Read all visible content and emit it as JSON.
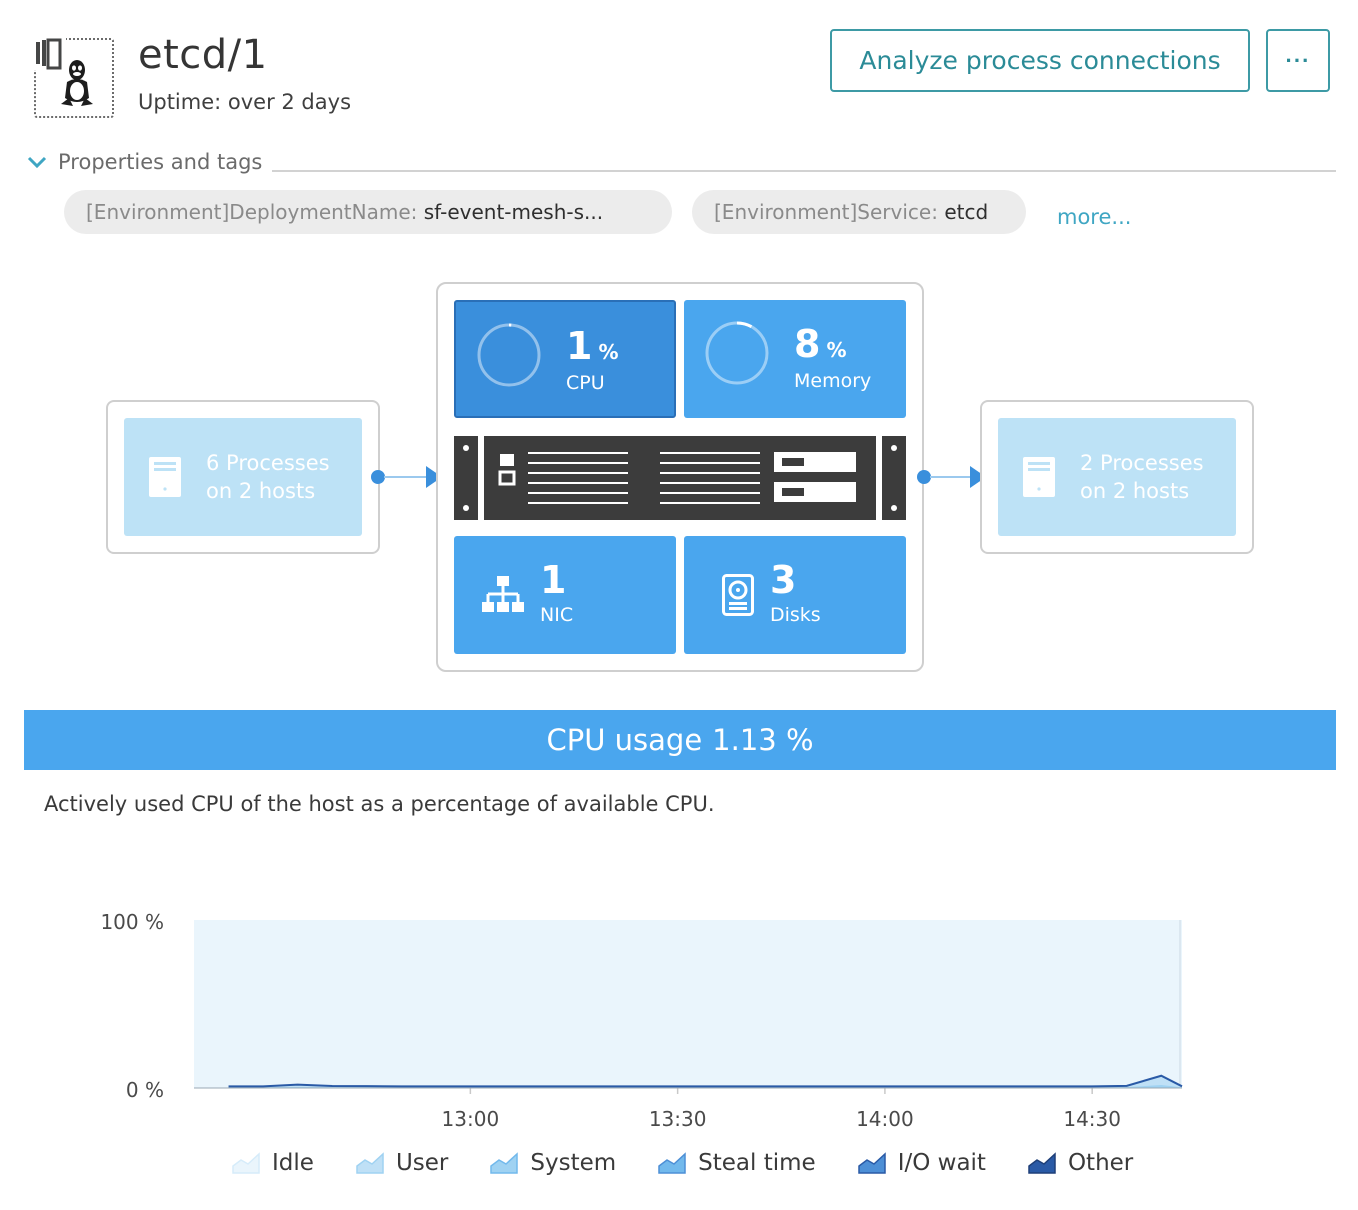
{
  "header": {
    "title": "etcd/1",
    "uptime": "Uptime: over 2 days",
    "analyze_button": "Analyze process connections",
    "more_button": "···"
  },
  "properties": {
    "label": "Properties and tags",
    "tags": [
      {
        "key": "[Environment]DeploymentName:",
        "value": "sf-event-mesh-s..."
      },
      {
        "key": "[Environment]Service:",
        "value": "etcd"
      }
    ],
    "more_link": "more..."
  },
  "infographic": {
    "incoming": {
      "line1": "6 Processes",
      "line2": "on 2 hosts"
    },
    "outgoing": {
      "line1": "2 Processes",
      "line2": "on 2 hosts"
    },
    "cpu": {
      "value": "1",
      "unit": "%",
      "label": "CPU",
      "fraction": 0.01
    },
    "memory": {
      "value": "8",
      "unit": "%",
      "label": "Memory",
      "fraction": 0.08
    },
    "nic": {
      "value": "1",
      "label": "NIC"
    },
    "disks": {
      "value": "3",
      "label": "Disks"
    }
  },
  "banner": {
    "title": "CPU usage",
    "value": "1.13 %"
  },
  "description": "Actively used CPU of the host as a percentage of available CPU.",
  "colors": {
    "accent": "#4aa6ee",
    "accent_dark": "#3a8fdc",
    "teal": "#2b8b97",
    "chart_bg": "#eaf5fc",
    "idle": "#eaf5fc",
    "user": "#bfe0f6",
    "system": "#9fd2f2",
    "steal": "#72b9ec",
    "iowait": "#4d8fd6",
    "other": "#2a5aa6"
  },
  "chart_data": {
    "type": "area",
    "x": [
      "12:25",
      "12:30",
      "12:35",
      "12:40",
      "12:45",
      "12:50",
      "12:55",
      "13:00",
      "13:05",
      "13:10",
      "13:15",
      "13:20",
      "13:25",
      "13:30",
      "13:35",
      "13:40",
      "13:45",
      "13:50",
      "13:55",
      "14:00",
      "14:05",
      "14:10",
      "14:15",
      "14:20",
      "14:25",
      "14:30",
      "14:35",
      "14:40",
      "14:43"
    ],
    "x_ticks": [
      "13:00",
      "13:30",
      "14:00",
      "14:30"
    ],
    "y_ticks": [
      "0 %",
      "100 %"
    ],
    "ylim": [
      0,
      100
    ],
    "series": [
      {
        "name": "Idle",
        "values": [
          99,
          99,
          98,
          99,
          99,
          99,
          99,
          99,
          99,
          99,
          99,
          99,
          99,
          99,
          99,
          99,
          99,
          99,
          99,
          99,
          99,
          99,
          99,
          99,
          99,
          99,
          99,
          92,
          99
        ]
      },
      {
        "name": "User",
        "values": [
          0.6,
          0.6,
          1.4,
          0.8,
          0.7,
          0.6,
          0.6,
          0.6,
          0.6,
          0.6,
          0.6,
          0.6,
          0.6,
          0.6,
          0.6,
          0.6,
          0.6,
          0.6,
          0.6,
          0.6,
          0.6,
          0.6,
          0.6,
          0.6,
          0.6,
          0.6,
          0.8,
          5.5,
          0.6
        ]
      },
      {
        "name": "System",
        "values": [
          0.3,
          0.3,
          0.5,
          0.3,
          0.3,
          0.3,
          0.3,
          0.3,
          0.3,
          0.3,
          0.3,
          0.3,
          0.3,
          0.3,
          0.3,
          0.3,
          0.3,
          0.3,
          0.3,
          0.3,
          0.3,
          0.3,
          0.3,
          0.3,
          0.3,
          0.3,
          0.4,
          1.5,
          0.3
        ]
      },
      {
        "name": "Steal time",
        "values": [
          0,
          0,
          0,
          0,
          0,
          0,
          0,
          0,
          0,
          0,
          0,
          0,
          0,
          0,
          0,
          0,
          0,
          0,
          0,
          0,
          0,
          0,
          0,
          0,
          0,
          0,
          0,
          0,
          0
        ]
      },
      {
        "name": "I/O wait",
        "values": [
          0.1,
          0.1,
          0.1,
          0.1,
          0.1,
          0.1,
          0.1,
          0.1,
          0.1,
          0.1,
          0.1,
          0.1,
          0.1,
          0.1,
          0.1,
          0.1,
          0.1,
          0.1,
          0.1,
          0.1,
          0.1,
          0.1,
          0.1,
          0.1,
          0.1,
          0.1,
          0.1,
          0.3,
          0.1
        ]
      },
      {
        "name": "Other",
        "values": [
          0,
          0,
          0,
          0,
          0,
          0,
          0,
          0,
          0,
          0,
          0,
          0,
          0,
          0,
          0,
          0,
          0,
          0,
          0,
          0,
          0,
          0,
          0,
          0,
          0,
          0,
          0,
          0,
          0
        ]
      }
    ]
  },
  "legend": [
    "Idle",
    "User",
    "System",
    "Steal time",
    "I/O wait",
    "Other"
  ]
}
